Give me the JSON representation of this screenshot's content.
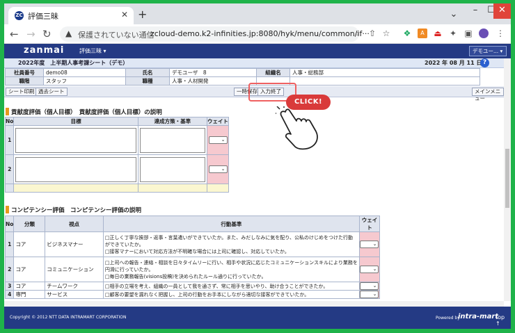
{
  "browser": {
    "tab_title": "評価三昧",
    "favicon_text": "ZC",
    "new_tab": "+",
    "security_label": "保護されていない通信",
    "url": "zcloud-demo.k2-infinities.jp:8080/hyk/menu/common/if···"
  },
  "app": {
    "logo": "zanmai",
    "menu_label": "評価三昧 ▾",
    "user_label": "デモユー... ▾",
    "sheet_title": "2022年度　上半期人事考課シート（デモ）",
    "date": "2022 年 08 月 11 日",
    "help": "?"
  },
  "info": {
    "emp_no_label": "社員番号",
    "emp_no": "demo08",
    "name_label": "氏名",
    "name": "デモユーザ　8",
    "org_label": "組織名",
    "org": "人事・総務部",
    "rank_label": "職階",
    "rank": "スタッフ",
    "job_label": "職種",
    "job": "人事・人材開発"
  },
  "buttons": {
    "print": "シート印刷",
    "past": "過去シート",
    "temp_save": "一時保存",
    "finish": "入力終了",
    "main_menu": "メインメニュー"
  },
  "callout": {
    "click": "CLICK!"
  },
  "contrib": {
    "title": "貢献度評価（個人目標）　貢献度評価（個人目標）の説明",
    "headers": {
      "no": "No",
      "goal": "目標",
      "method": "達成方策・基準",
      "weight": "ウェイト"
    },
    "rows": [
      {
        "no": "1"
      },
      {
        "no": "2"
      }
    ]
  },
  "comp": {
    "title": "コンピテンシー評価　コンピテンシー評価の説明",
    "headers": {
      "no": "No",
      "cat": "分類",
      "view": "視点",
      "crit": "行動基準",
      "weight": "ウェイト"
    },
    "rows": [
      {
        "no": "1",
        "cat": "コア",
        "view": "ビジネスマナー",
        "crit": "□正しく丁寧な挨拶・返事・言葉遣いができていたか。また、みだしなみに気を配り、公私のけじめをつけた行動ができていたか。\n□接客マナーにおいて対応方法が不明確な場合には上司に確認し、対応していたか。"
      },
      {
        "no": "2",
        "cat": "コア",
        "view": "コミュニケーション",
        "crit": "□上司への報告・連絡・相談を日々タイムリーに行い、相手や状況に応じたコミュニケーションスキルにより業務を円滑に行っていたか。\n□毎日の業務報告(visions投稿)を決められたルール通りに行っていたか。"
      },
      {
        "no": "3",
        "cat": "コア",
        "view": "チームワーク",
        "crit": "□相手の立場を考え、組織の一員として我を通さず、常に相手を思いやり、助け合うことができたか。"
      },
      {
        "no": "4",
        "cat": "専門",
        "view": "サービス",
        "crit": "□顧客の要望を漏れなく把握し、上司の行動をお手本にしながら適切な接客ができていたか。"
      }
    ]
  },
  "footer": {
    "copyright": "Copyright © 2012 NTT DATA INTRAMART CORPORATION",
    "powered": "Powered by",
    "brand": "intra-mart",
    "top": "top ↑"
  }
}
